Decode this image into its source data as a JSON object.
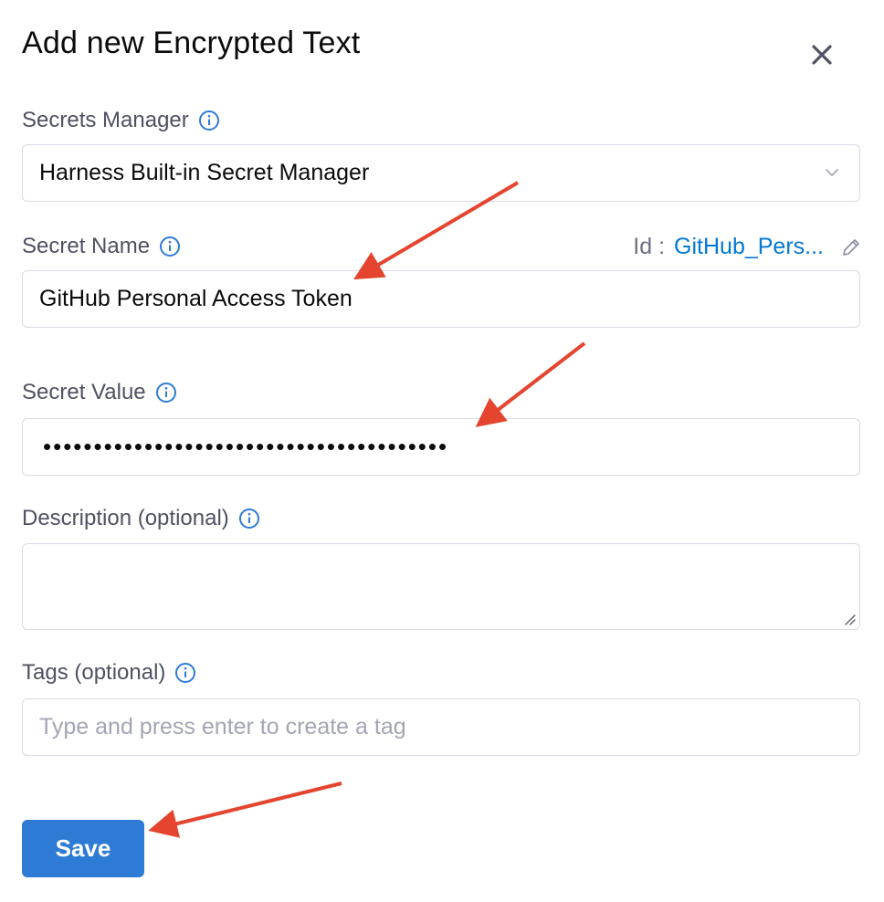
{
  "dialog": {
    "title": "Add new Encrypted Text"
  },
  "secrets_manager": {
    "label": "Secrets Manager",
    "value": "Harness Built-in Secret Manager"
  },
  "secret_name": {
    "label": "Secret Name",
    "id_label": "Id :",
    "id_value": "GitHub_Pers...",
    "value": "GitHub Personal Access Token"
  },
  "secret_value": {
    "label": "Secret Value",
    "masked_value": "••••••••••••••••••••••••••••••••••••••••"
  },
  "description": {
    "label": "Description (optional)",
    "value": ""
  },
  "tags": {
    "label": "Tags (optional)",
    "placeholder": "Type and press enter to create a tag"
  },
  "actions": {
    "save_label": "Save"
  },
  "colors": {
    "primary": "#2e7bd6",
    "link": "#0278d5",
    "annotation_arrow": "#e5452f"
  },
  "icons": [
    "close-icon",
    "info-icon",
    "chevron-down-icon",
    "pencil-icon",
    "resize-handle-icon"
  ]
}
